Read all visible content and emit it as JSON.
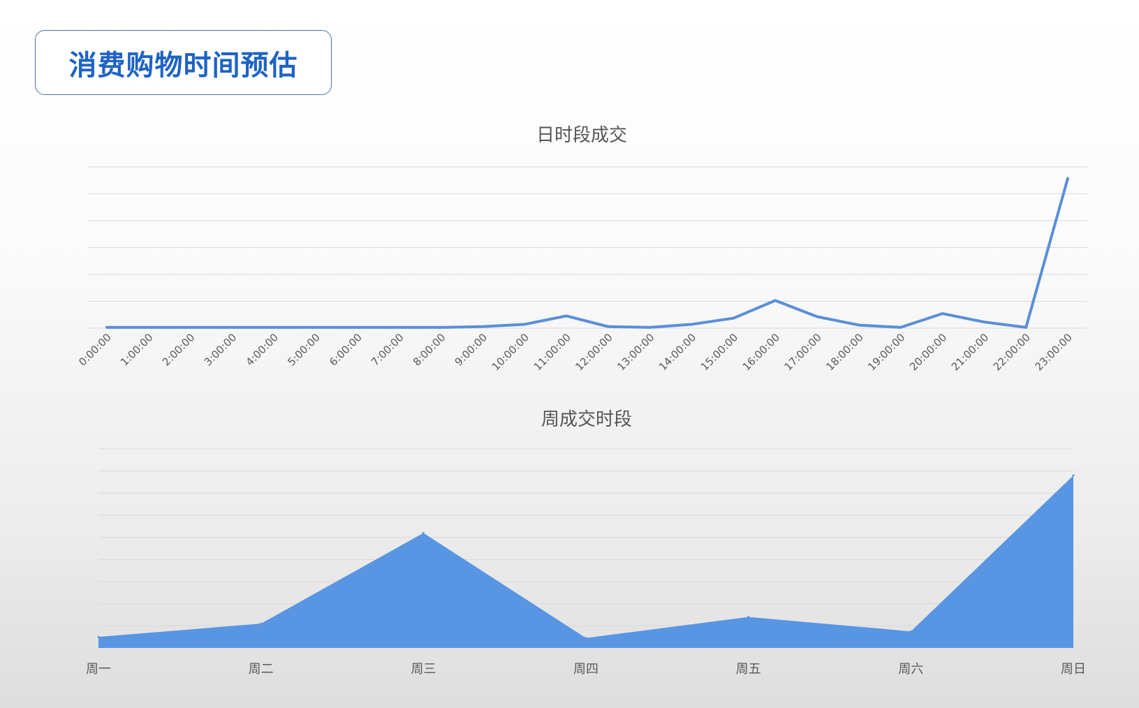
{
  "page": {
    "title": "消费购物时间预估"
  },
  "chart_data": [
    {
      "type": "line",
      "title": "日时段成交",
      "categories": [
        "0:00:00",
        "1:00:00",
        "2:00:00",
        "3:00:00",
        "4:00:00",
        "5:00:00",
        "6:00:00",
        "7:00:00",
        "8:00:00",
        "9:00:00",
        "10:00:00",
        "11:00:00",
        "12:00:00",
        "13:00:00",
        "14:00:00",
        "15:00:00",
        "16:00:00",
        "17:00:00",
        "18:00:00",
        "19:00:00",
        "20:00:00",
        "21:00:00",
        "22:00:00",
        "23:00:00"
      ],
      "values": [
        0.1,
        0.1,
        0.1,
        0.1,
        0.1,
        0.1,
        0.1,
        0.1,
        0.1,
        0.2,
        0.5,
        1.6,
        0.2,
        0.1,
        0.5,
        1.3,
        3.6,
        1.5,
        0.4,
        0.1,
        1.9,
        0.8,
        0.1,
        19.5
      ],
      "ylim": [
        0,
        21
      ],
      "gridlines": 7,
      "grid": true,
      "color": "#5a8fd8"
    },
    {
      "type": "area",
      "title": "周成交时段",
      "categories": [
        "周一",
        "周二",
        "周三",
        "周四",
        "周五",
        "周六",
        "周日"
      ],
      "values": [
        0.5,
        1.1,
        5.2,
        0.45,
        1.4,
        0.75,
        7.8
      ],
      "ylim": [
        0,
        9
      ],
      "gridlines": 9,
      "grid": true,
      "color": "#5895e3"
    }
  ]
}
